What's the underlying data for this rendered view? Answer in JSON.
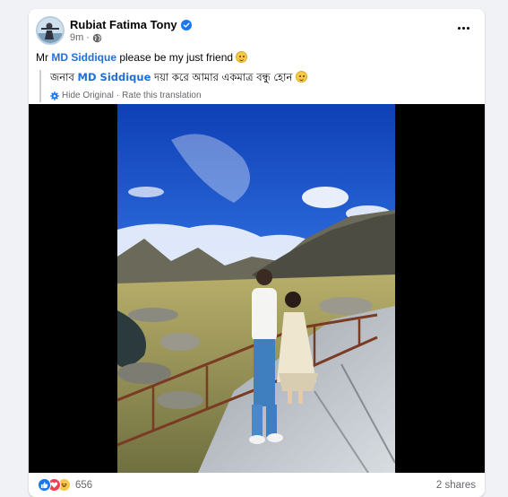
{
  "post": {
    "author": "Rubiat Fatima Tony",
    "time": "9m",
    "caption": {
      "before": "Mr ",
      "mention": "MD Siddique",
      "after": " please be my just friend"
    },
    "translation": {
      "before": "জনাব ",
      "mention": "MD Siddique",
      "after": " দয়া করে আমার একমাত্র বন্ধু হোন",
      "hide_label": "Hide Original",
      "separator": "·",
      "rate_label": "Rate this translation"
    },
    "reactions": {
      "types": [
        "like",
        "love",
        "haha"
      ],
      "count": "656"
    },
    "shares": "2 shares"
  },
  "icons": {
    "verified": "verified-badge-icon",
    "audience": "globe-icon",
    "more": "more-options-icon",
    "translate": "gear-icon"
  },
  "colors": {
    "mention": "#216fdb",
    "like": "#1877f2",
    "love": "#f33e58",
    "haha": "#f7c948"
  }
}
